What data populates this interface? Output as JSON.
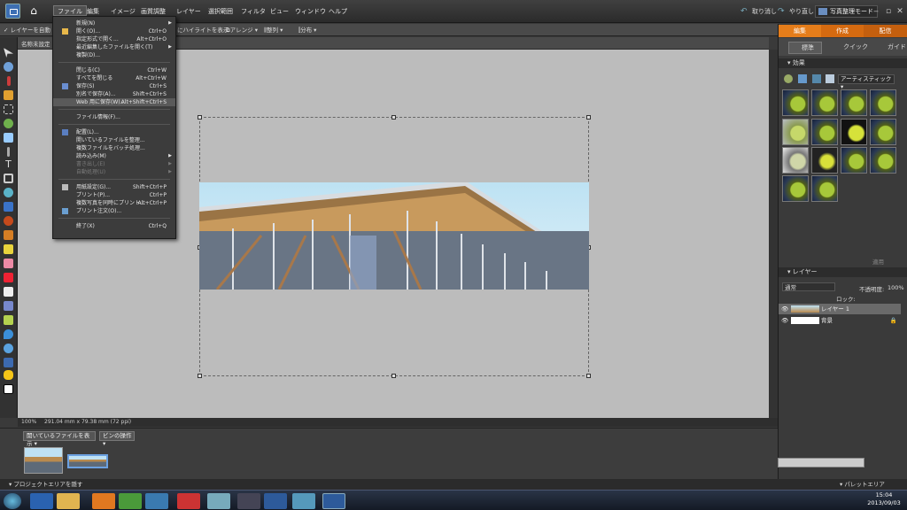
{
  "menubar": {
    "items": [
      "ファイル",
      "編集",
      "イメージ",
      "画質調整",
      "レイヤー",
      "選択範囲",
      "フィルタ",
      "ビュー",
      "ウィンドウ",
      "ヘルプ"
    ],
    "undo": "取り消し",
    "redo": "やり直し",
    "organizer": "写真整理モード"
  },
  "options": {
    "auto_select": "レイヤーを自動",
    "highlight": "にハイライトを表示",
    "arrange": "アレンジ",
    "align": "整列",
    "distribute": "分布"
  },
  "file_menu": [
    {
      "label": "新規(N)",
      "shortcut": "",
      "submenu": true
    },
    {
      "label": "開く(O)...",
      "shortcut": "Ctrl+O"
    },
    {
      "label": "指定形式で開く...",
      "shortcut": "Alt+Ctrl+O"
    },
    {
      "label": "最近編集したファイルを開く(T)",
      "shortcut": "",
      "submenu": true
    },
    {
      "label": "複製(D)...",
      "shortcut": ""
    },
    {
      "sep": true
    },
    {
      "label": "閉じる(C)",
      "shortcut": "Ctrl+W"
    },
    {
      "label": "すべてを閉じる",
      "shortcut": "Alt+Ctrl+W"
    },
    {
      "label": "保存(S)",
      "shortcut": "Ctrl+S"
    },
    {
      "label": "別名で保存(A)...",
      "shortcut": "Shift+Ctrl+S"
    },
    {
      "label": "Web 用に保存(W)...",
      "shortcut": "Alt+Shift+Ctrl+S",
      "highlight": true
    },
    {
      "sep": true
    },
    {
      "label": "ファイル情報(F)...",
      "shortcut": ""
    },
    {
      "sep": true
    },
    {
      "label": "配置(L)...",
      "shortcut": ""
    },
    {
      "label": "開いているファイルを整理...",
      "shortcut": ""
    },
    {
      "label": "複数ファイルをバッチ処理...",
      "shortcut": ""
    },
    {
      "label": "読み込み(M)",
      "shortcut": "",
      "submenu": true
    },
    {
      "label": "書き出し(E)",
      "shortcut": "",
      "submenu": true,
      "disabled": true
    },
    {
      "label": "自動処理(U)",
      "shortcut": "",
      "submenu": true,
      "disabled": true
    },
    {
      "sep": true
    },
    {
      "label": "用紙設定(G)...",
      "shortcut": "Shift+Ctrl+P"
    },
    {
      "label": "プリント(P)...",
      "shortcut": "Ctrl+P"
    },
    {
      "label": "複数写真を同時にプリント...",
      "shortcut": "Alt+Ctrl+P"
    },
    {
      "label": "プリント注文(O)...",
      "shortcut": ""
    },
    {
      "sep": true
    },
    {
      "label": "終了(X)",
      "shortcut": "Ctrl+Q"
    }
  ],
  "document": {
    "tab_title": "名称未設定"
  },
  "status": {
    "zoom": "100%",
    "size": "291.04 mm x 79.38 mm (72 ppi)"
  },
  "project_bin": {
    "show_select": "開いているファイルを表示",
    "action": "ビンの操作",
    "footer": "プロジェクトエリアを隠す"
  },
  "right_panel": {
    "tabs": [
      "編集",
      "作成",
      "配信"
    ],
    "subtabs": [
      "標準",
      "クイック",
      "ガイド"
    ],
    "effects_title": "効果",
    "effects_category": "アーティスティック",
    "apply": "適用",
    "layers_title": "レイヤー",
    "blend": "通常",
    "opacity_label": "不透明度:",
    "opacity": "100%",
    "lock": "ロック:",
    "layers": [
      "レイヤー 1",
      "背景"
    ],
    "palette_footer": "パレットエリア"
  },
  "taskbar": {
    "time": "15:04",
    "date": "2013/09/03"
  }
}
